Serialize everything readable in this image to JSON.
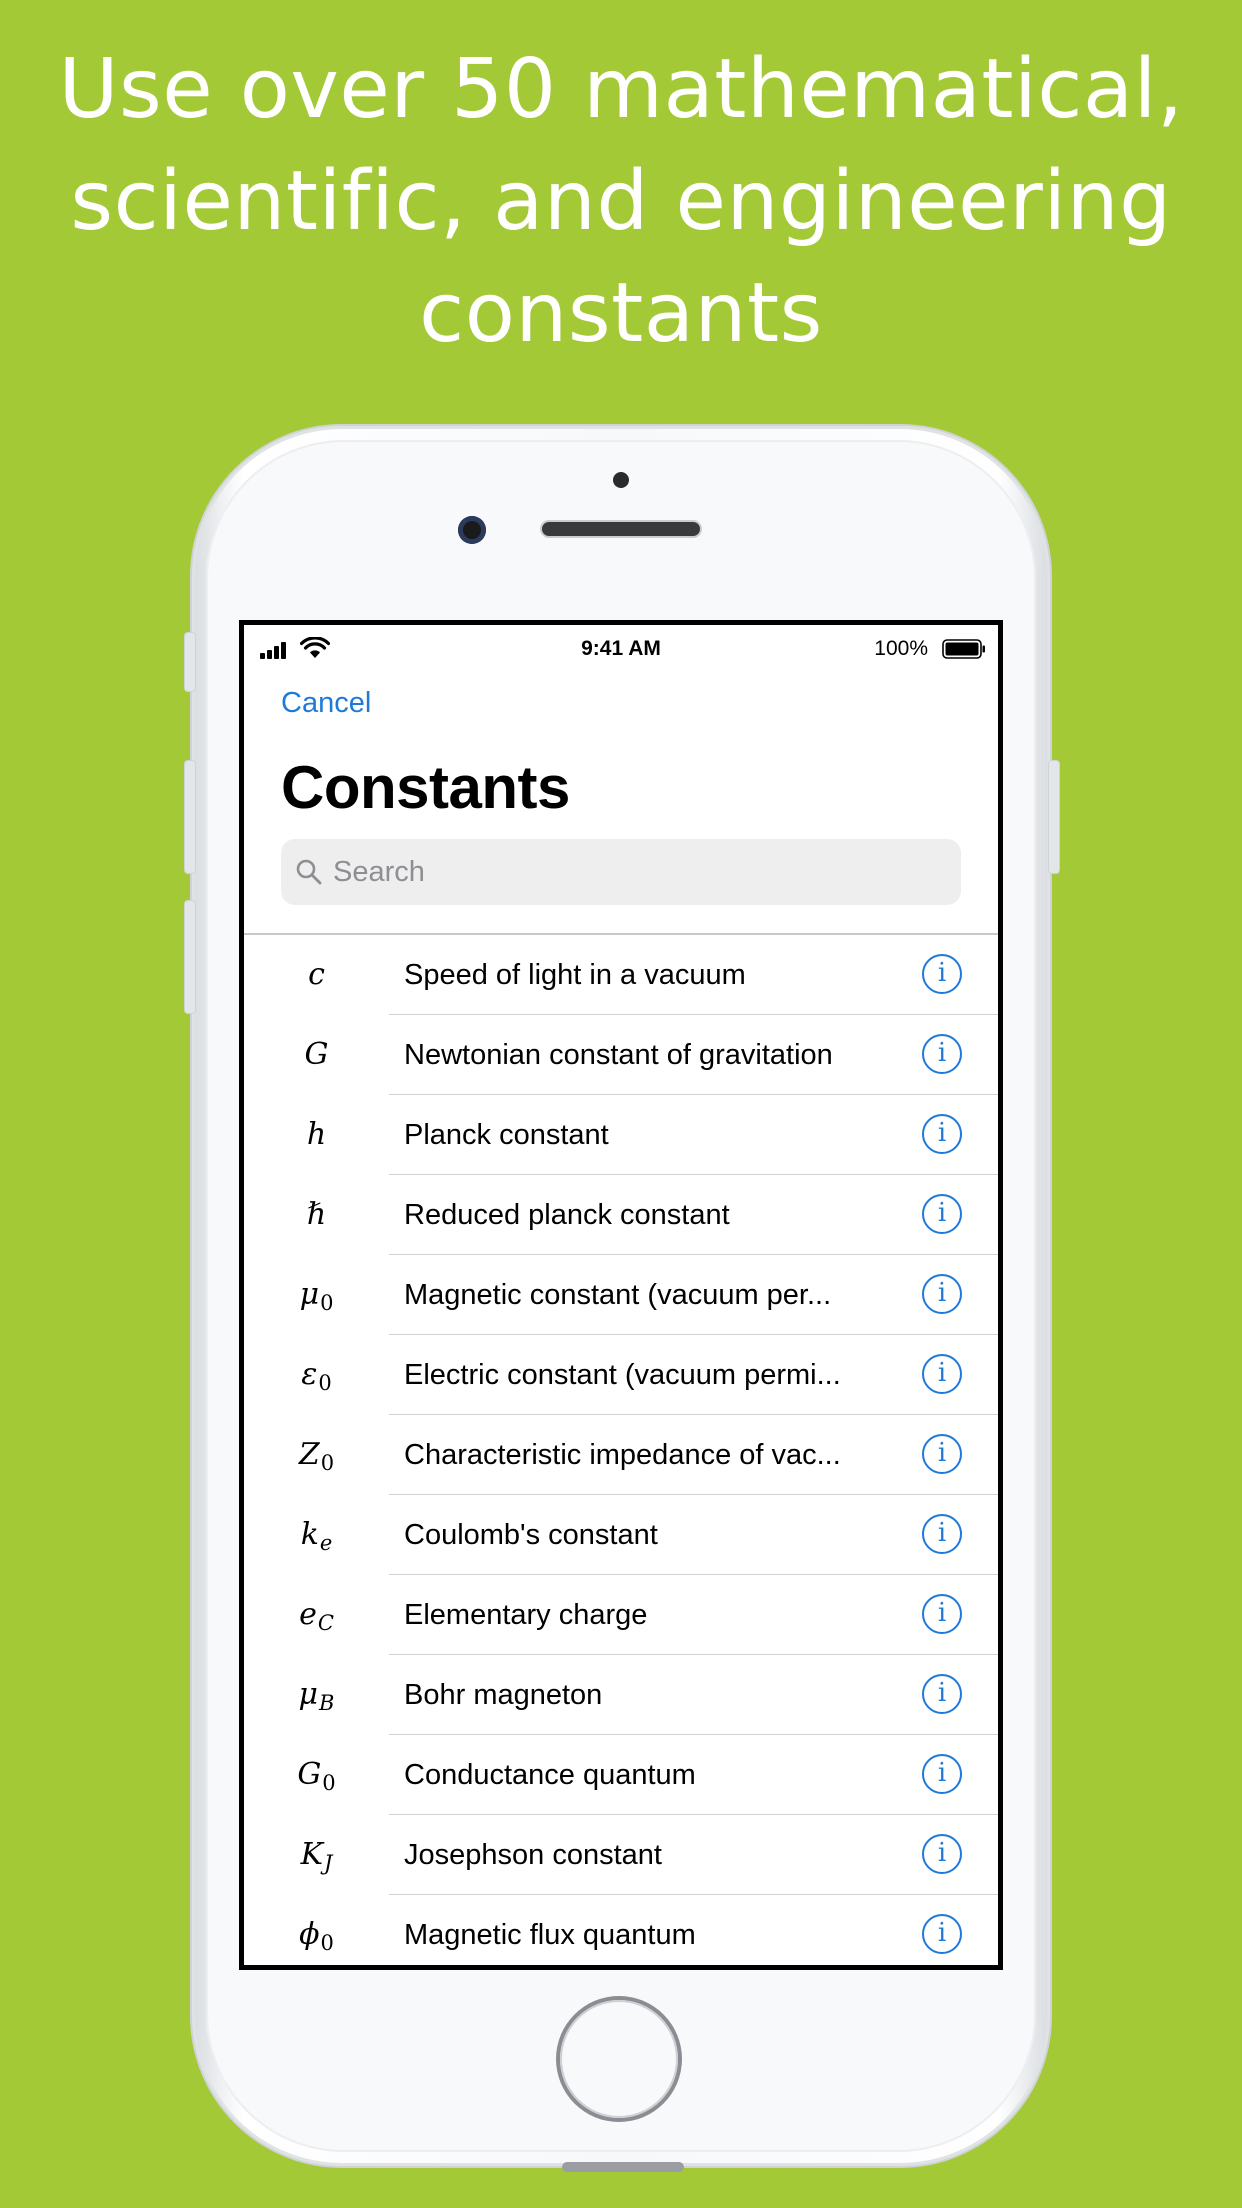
{
  "headline": {
    "line1": "Use over 50 mathematical,",
    "line2": "scientific, and engineering",
    "line3": "constants"
  },
  "status_bar": {
    "time": "9:41 AM",
    "battery": "100%"
  },
  "nav": {
    "cancel_label": "Cancel",
    "title": "Constants"
  },
  "search": {
    "placeholder": "Search"
  },
  "colors": {
    "background": "#a3c937",
    "accent": "#1e7ad8"
  },
  "constants": [
    {
      "base": "c",
      "sub": "",
      "name": "Speed of light in a vacuum"
    },
    {
      "base": "G",
      "sub": "",
      "name": "Newtonian constant of gravitation"
    },
    {
      "base": "h",
      "sub": "",
      "name": "Planck constant"
    },
    {
      "base": "ℏ",
      "sub": "",
      "name": "Reduced planck constant"
    },
    {
      "base": "μ",
      "sub": "0",
      "name": "Magnetic constant (vacuum per..."
    },
    {
      "base": "ε",
      "sub": "0",
      "name": "Electric constant (vacuum permi..."
    },
    {
      "base": "Z",
      "sub": "0",
      "name": "Characteristic impedance of vac..."
    },
    {
      "base": "k",
      "sub": "e",
      "name": "Coulomb's constant"
    },
    {
      "base": "e",
      "sub": "C",
      "name": "Elementary charge"
    },
    {
      "base": "μ",
      "sub": "B",
      "name": "Bohr magneton"
    },
    {
      "base": "G",
      "sub": "0",
      "name": "Conductance quantum"
    },
    {
      "base": "K",
      "sub": "J",
      "name": "Josephson constant"
    },
    {
      "base": "ϕ",
      "sub": "0",
      "name": "Magnetic flux quantum"
    }
  ]
}
